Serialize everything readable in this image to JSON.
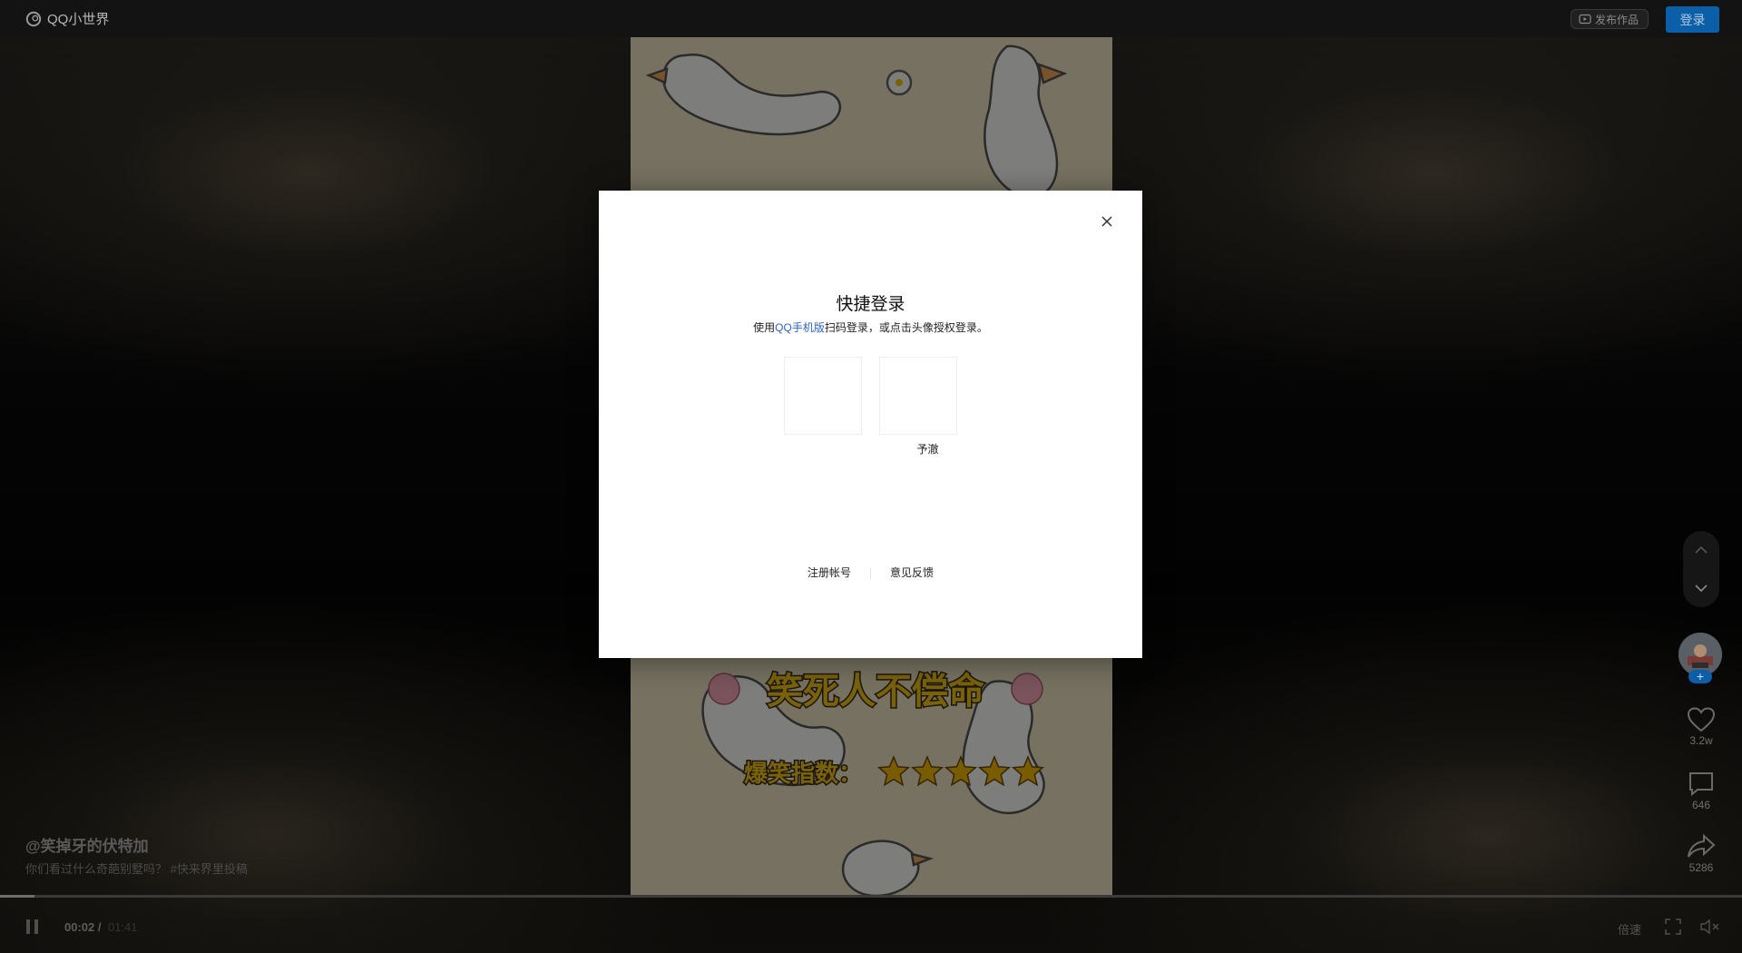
{
  "header": {
    "logo_text": "QQ小世界",
    "publish_label": "发布作品",
    "login_label": "登录"
  },
  "video": {
    "headline": "笑死人不偿命",
    "rating_label": "爆笑指数：",
    "rating_stars": 5,
    "author": "@笑掉牙的伏特加",
    "description": "你们看过什么奇葩别墅吗？ #快来界里投稿"
  },
  "player": {
    "current_time": "00:02 /",
    "duration": "01:41",
    "speed_label": "倍速",
    "progress": 0.0198
  },
  "rail": {
    "likes": "3.2w",
    "comments": "646",
    "shares": "5286",
    "follow_symbol": "+"
  },
  "modal": {
    "title": "快捷登录",
    "subtitle_prefix": "使用",
    "subtitle_link": "QQ手机版",
    "subtitle_suffix": "扫码登录，或点击头像授权登录。",
    "account_name": "予澈",
    "register_label": "注册帐号",
    "feedback_label": "意见反馈"
  },
  "icons": {
    "logo": "qq-world-logo-icon",
    "publish": "video-upload-icon",
    "close": "close-icon",
    "nav_up": "chevron-up-icon",
    "nav_down": "chevron-down-icon",
    "like": "heart-icon",
    "comment": "comment-icon",
    "share": "share-icon",
    "pause": "pause-icon",
    "fullscreen": "fullscreen-icon",
    "mute": "mute-icon"
  },
  "colors": {
    "login_button": "#0a5fa8",
    "link": "#2f63c7",
    "headline_text": "#f0c419",
    "star": "#f5b800"
  }
}
